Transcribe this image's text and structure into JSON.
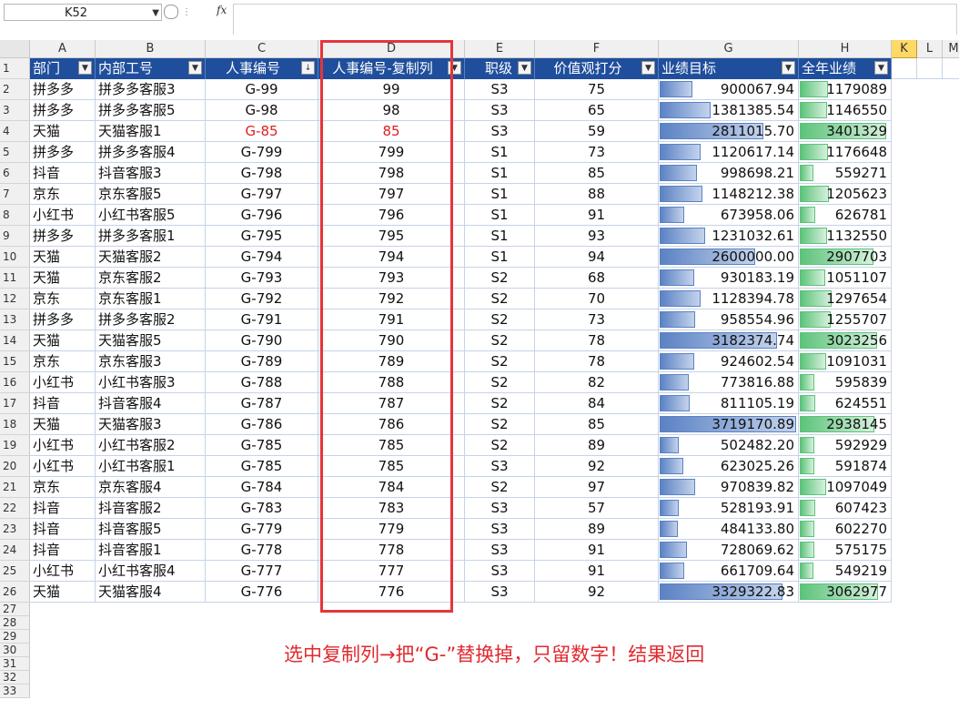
{
  "name_box": {
    "value": "K52",
    "dropdown": "▼"
  },
  "formula_bar": {
    "fx_label": "fx",
    "value": ""
  },
  "columns": [
    "A",
    "B",
    "C",
    "D",
    "E",
    "F",
    "G",
    "H",
    "K",
    "L",
    "M"
  ],
  "selected_column": "K",
  "headers": {
    "dept": "部门",
    "internal_id": "内部工号",
    "hr_id": "人事编号",
    "hr_id_copy": "人事编号-复制列",
    "level": "职级",
    "score": "价值观打分",
    "target": "业绩目标",
    "annual": "全年业绩"
  },
  "rows": [
    {
      "n": "2",
      "dept": "拼多多",
      "internal_id": "拼多多客服3",
      "hr_id": "G-99",
      "hr_copy": "99",
      "level": "S3",
      "score": "75",
      "target": "900067.94",
      "annual": "1179089",
      "target_fill": 0.24,
      "annual_fill": 0.32
    },
    {
      "n": "3",
      "dept": "拼多多",
      "internal_id": "拼多多客服5",
      "hr_id": "G-98",
      "hr_copy": "98",
      "level": "S3",
      "score": "65",
      "target": "1381385.54",
      "annual": "1146550",
      "target_fill": 0.37,
      "annual_fill": 0.31
    },
    {
      "n": "4",
      "dept": "天猫",
      "internal_id": "天猫客服1",
      "hr_id": "G-85",
      "hr_copy": "85",
      "level": "S3",
      "score": "59",
      "target": "2811015.70",
      "annual": "3401329",
      "target_fill": 0.76,
      "annual_fill": 0.97,
      "red": true
    },
    {
      "n": "5",
      "dept": "拼多多",
      "internal_id": "拼多多客服4",
      "hr_id": "G-799",
      "hr_copy": "799",
      "level": "S1",
      "score": "73",
      "target": "1120617.14",
      "annual": "1176648",
      "target_fill": 0.3,
      "annual_fill": 0.32
    },
    {
      "n": "6",
      "dept": "抖音",
      "internal_id": "抖音客服3",
      "hr_id": "G-798",
      "hr_copy": "798",
      "level": "S1",
      "score": "85",
      "target": "998698.21",
      "annual": "559271",
      "target_fill": 0.27,
      "annual_fill": 0.15
    },
    {
      "n": "7",
      "dept": "京东",
      "internal_id": "京东客服5",
      "hr_id": "G-797",
      "hr_copy": "797",
      "level": "S1",
      "score": "88",
      "target": "1148212.38",
      "annual": "1205623",
      "target_fill": 0.31,
      "annual_fill": 0.33
    },
    {
      "n": "8",
      "dept": "小红书",
      "internal_id": "小红书客服5",
      "hr_id": "G-796",
      "hr_copy": "796",
      "level": "S1",
      "score": "91",
      "target": "673958.06",
      "annual": "626781",
      "target_fill": 0.18,
      "annual_fill": 0.17
    },
    {
      "n": "9",
      "dept": "拼多多",
      "internal_id": "拼多多客服1",
      "hr_id": "G-795",
      "hr_copy": "795",
      "level": "S1",
      "score": "93",
      "target": "1231032.61",
      "annual": "1132550",
      "target_fill": 0.33,
      "annual_fill": 0.31
    },
    {
      "n": "10",
      "dept": "天猫",
      "internal_id": "天猫客服2",
      "hr_id": "G-794",
      "hr_copy": "794",
      "level": "S1",
      "score": "94",
      "target": "2600000.00",
      "annual": "2907703",
      "target_fill": 0.7,
      "annual_fill": 0.83
    },
    {
      "n": "11",
      "dept": "天猫",
      "internal_id": "京东客服2",
      "hr_id": "G-793",
      "hr_copy": "793",
      "level": "S2",
      "score": "68",
      "target": "930183.19",
      "annual": "1051107",
      "target_fill": 0.25,
      "annual_fill": 0.29
    },
    {
      "n": "12",
      "dept": "京东",
      "internal_id": "京东客服1",
      "hr_id": "G-792",
      "hr_copy": "792",
      "level": "S2",
      "score": "70",
      "target": "1128394.78",
      "annual": "1297654",
      "target_fill": 0.3,
      "annual_fill": 0.36
    },
    {
      "n": "13",
      "dept": "拼多多",
      "internal_id": "拼多多客服2",
      "hr_id": "G-791",
      "hr_copy": "791",
      "level": "S2",
      "score": "73",
      "target": "958554.96",
      "annual": "1255707",
      "target_fill": 0.26,
      "annual_fill": 0.35
    },
    {
      "n": "14",
      "dept": "天猫",
      "internal_id": "天猫客服5",
      "hr_id": "G-790",
      "hr_copy": "790",
      "level": "S2",
      "score": "78",
      "target": "3182374.74",
      "annual": "3023256",
      "target_fill": 0.86,
      "annual_fill": 0.87
    },
    {
      "n": "15",
      "dept": "京东",
      "internal_id": "京东客服3",
      "hr_id": "G-789",
      "hr_copy": "789",
      "level": "S2",
      "score": "78",
      "target": "924602.54",
      "annual": "1091031",
      "target_fill": 0.25,
      "annual_fill": 0.3
    },
    {
      "n": "16",
      "dept": "小红书",
      "internal_id": "小红书客服3",
      "hr_id": "G-788",
      "hr_copy": "788",
      "level": "S2",
      "score": "82",
      "target": "773816.88",
      "annual": "595839",
      "target_fill": 0.21,
      "annual_fill": 0.16
    },
    {
      "n": "17",
      "dept": "抖音",
      "internal_id": "抖音客服4",
      "hr_id": "G-787",
      "hr_copy": "787",
      "level": "S2",
      "score": "84",
      "target": "811105.19",
      "annual": "624551",
      "target_fill": 0.22,
      "annual_fill": 0.17
    },
    {
      "n": "18",
      "dept": "天猫",
      "internal_id": "天猫客服3",
      "hr_id": "G-786",
      "hr_copy": "786",
      "level": "S2",
      "score": "85",
      "target": "3719170.89",
      "annual": "2938145",
      "target_fill": 1.0,
      "annual_fill": 0.84
    },
    {
      "n": "19",
      "dept": "小红书",
      "internal_id": "小红书客服2",
      "hr_id": "G-785",
      "hr_copy": "785",
      "level": "S2",
      "score": "89",
      "target": "502482.20",
      "annual": "592929",
      "target_fill": 0.14,
      "annual_fill": 0.16
    },
    {
      "n": "20",
      "dept": "小红书",
      "internal_id": "小红书客服1",
      "hr_id": "G-785",
      "hr_copy": "785",
      "level": "S3",
      "score": "92",
      "target": "623025.26",
      "annual": "591874",
      "target_fill": 0.17,
      "annual_fill": 0.16
    },
    {
      "n": "21",
      "dept": "京东",
      "internal_id": "京东客服4",
      "hr_id": "G-784",
      "hr_copy": "784",
      "level": "S2",
      "score": "97",
      "target": "970839.82",
      "annual": "1097049",
      "target_fill": 0.26,
      "annual_fill": 0.3
    },
    {
      "n": "22",
      "dept": "抖音",
      "internal_id": "抖音客服2",
      "hr_id": "G-783",
      "hr_copy": "783",
      "level": "S3",
      "score": "57",
      "target": "528193.91",
      "annual": "607423",
      "target_fill": 0.14,
      "annual_fill": 0.17
    },
    {
      "n": "23",
      "dept": "抖音",
      "internal_id": "抖音客服5",
      "hr_id": "G-779",
      "hr_copy": "779",
      "level": "S3",
      "score": "89",
      "target": "484133.80",
      "annual": "602270",
      "target_fill": 0.13,
      "annual_fill": 0.16
    },
    {
      "n": "24",
      "dept": "抖音",
      "internal_id": "抖音客服1",
      "hr_id": "G-778",
      "hr_copy": "778",
      "level": "S3",
      "score": "91",
      "target": "728069.62",
      "annual": "575175",
      "target_fill": 0.2,
      "annual_fill": 0.16
    },
    {
      "n": "25",
      "dept": "小红书",
      "internal_id": "小红书客服4",
      "hr_id": "G-777",
      "hr_copy": "777",
      "level": "S3",
      "score": "91",
      "target": "661709.64",
      "annual": "549219",
      "target_fill": 0.18,
      "annual_fill": 0.15
    },
    {
      "n": "26",
      "dept": "天猫",
      "internal_id": "天猫客服4",
      "hr_id": "G-776",
      "hr_copy": "776",
      "level": "S3",
      "score": "92",
      "target": "3329322.83",
      "annual": "3062977",
      "target_fill": 0.9,
      "annual_fill": 0.88
    }
  ],
  "empty_rows": [
    "27",
    "28",
    "29",
    "30",
    "31",
    "32",
    "33"
  ],
  "caption": "选中复制列→把“G-”替换掉，只留数字！结果返回",
  "colors": {
    "header_bg": "#1f4e9c",
    "highlight_red": "#e5353a",
    "bar_blue": "#5b82c4",
    "bar_green": "#5cc37a"
  }
}
